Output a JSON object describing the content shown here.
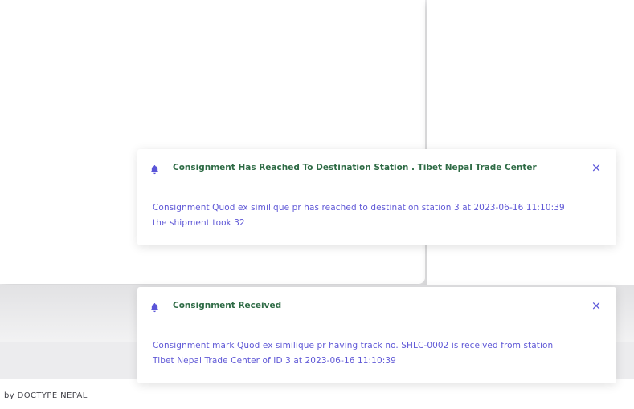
{
  "notifications": [
    {
      "icon": "bell-icon",
      "title": "Consignment Has Reached To Destination Station . Tibet Nepal Trade Center",
      "message_line1": "Consignment Quod ex similique pr has reached to destination station 3 at 2023-06-16 11:10:39",
      "message_line2": "the shipment took 32",
      "close_label": "×"
    },
    {
      "icon": "bell-icon",
      "title": "Consignment Received",
      "message_line1": "Consignment mark Quod ex similique pr having track no. SHLC-0002 is received from station",
      "message_line2": "Tibet Nepal Trade Center of ID 3 at 2023-06-16 11:10:39",
      "close_label": "×"
    }
  ],
  "footer": {
    "text": "by DOCTYPE NEPAL"
  },
  "colors": {
    "title": "#2e6b45",
    "message": "#5f58d6",
    "accent": "#5a55d8"
  }
}
